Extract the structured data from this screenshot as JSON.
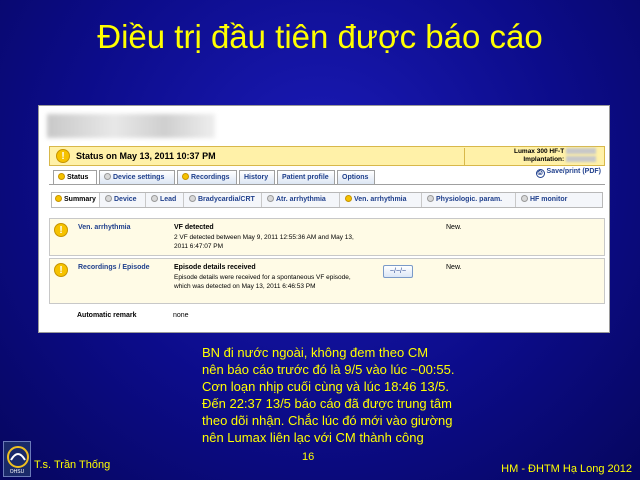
{
  "slide": {
    "title": "Điều trị đầu tiên được báo cáo",
    "note_lines": [
      "BN đi nước ngoài, không đem theo CM",
      "nên báo cáo trước đó là 9/5 vào lúc ~00:55.",
      "Cơn loạn nhịp cuối cùng và lúc 18:46 13/5.",
      "Đến 22:37 13/5 báo cáo đã được trung tâm",
      "theo dõi nhận. Chắc lúc đó mới vào giường",
      "nên Lumax liên lạc với CM thành công"
    ],
    "page_number": "16",
    "author": "T.s. Trần Thống",
    "footer_right": "HM - ĐHTM Hạ Long 2012",
    "logo_text": "OHSU"
  },
  "status_bar": {
    "text": "Status on May 13, 2011 10:37 PM",
    "device_line1": "Lumax 300 HF-T",
    "device_line2": "Implantation:"
  },
  "main_tabs": [
    {
      "label": "Status",
      "icon": "status-dot",
      "active": true
    },
    {
      "label": "Device settings",
      "icon": "grey-dot",
      "active": false
    },
    {
      "label": "Recordings",
      "icon": "status-dot",
      "active": false
    },
    {
      "label": "History",
      "icon": "",
      "active": false
    },
    {
      "label": "Patient profile",
      "icon": "",
      "active": false
    },
    {
      "label": "Options",
      "icon": "",
      "active": false
    }
  ],
  "save_print_label": "Save/print (PDF)",
  "sub_tabs": [
    {
      "label": "Summary",
      "active": true
    },
    {
      "label": "Device",
      "active": false
    },
    {
      "label": "Lead",
      "active": false
    },
    {
      "label": "Bradycardia/CRT",
      "active": false
    },
    {
      "label": "Atr. arrhythmia",
      "active": false
    },
    {
      "label": "Ven. arrhythmia",
      "active": false
    },
    {
      "label": "Physiologic. param.",
      "active": false
    },
    {
      "label": "HF monitor",
      "active": false
    }
  ],
  "rows": [
    {
      "category": "Ven. arrhythmia",
      "title": "VF detected",
      "detail": "2 VF detected between May 9, 2011 12:55:36 AM and May 13, 2011 6:47:07 PM",
      "status": "New."
    },
    {
      "category": "Recordings / Episode",
      "title": "Episode details received",
      "detail": "Episode details were received for a spontaneous VF episode, which was detected on May 13, 2011 6:46:53 PM",
      "status": "New.",
      "egm_button": "~/~/~"
    }
  ],
  "automatic_remark": {
    "label": "Automatic remark",
    "value": "none"
  },
  "colors": {
    "title": "#ffff00",
    "status_bar_bg": "#fff1a8",
    "link": "#1f3f8c",
    "warning": "#f6c200"
  }
}
